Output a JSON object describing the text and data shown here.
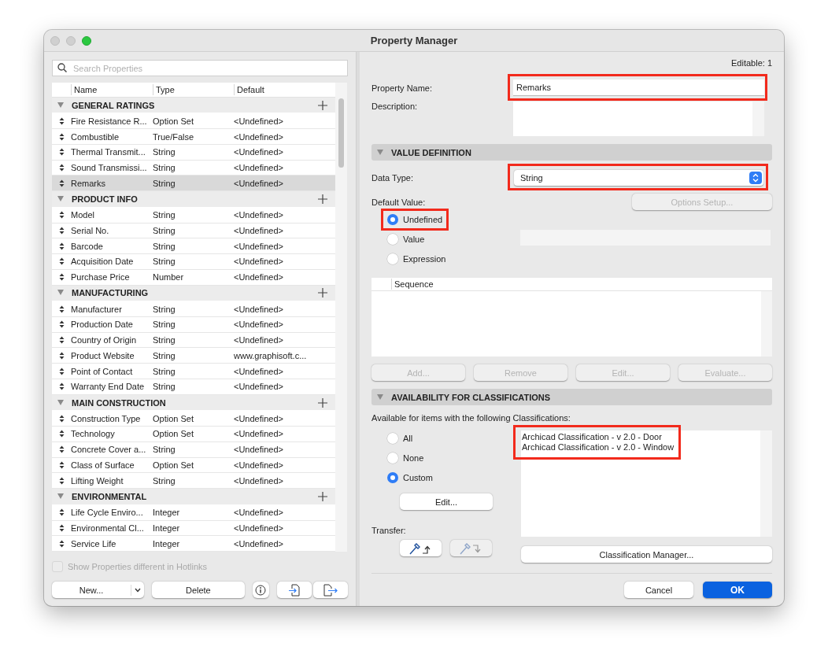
{
  "window": {
    "title": "Property Manager"
  },
  "search": {
    "placeholder": "Search Properties"
  },
  "table": {
    "columns": [
      "Name",
      "Type",
      "Default"
    ],
    "groups": [
      {
        "name": "GENERAL RATINGS",
        "expanded": true,
        "rows": [
          {
            "name": "Fire Resistance R...",
            "type": "Option Set",
            "default": "<Undefined>",
            "selected": false
          },
          {
            "name": "Combustible",
            "type": "True/False",
            "default": "<Undefined>",
            "selected": false
          },
          {
            "name": "Thermal Transmit...",
            "type": "String",
            "default": "<Undefined>",
            "selected": false
          },
          {
            "name": "Sound Transmissi...",
            "type": "String",
            "default": "<Undefined>",
            "selected": false
          },
          {
            "name": "Remarks",
            "type": "String",
            "default": "<Undefined>",
            "selected": true
          }
        ]
      },
      {
        "name": "PRODUCT INFO",
        "expanded": true,
        "rows": [
          {
            "name": "Model",
            "type": "String",
            "default": "<Undefined>",
            "selected": false
          },
          {
            "name": "Serial No.",
            "type": "String",
            "default": "<Undefined>",
            "selected": false
          },
          {
            "name": "Barcode",
            "type": "String",
            "default": "<Undefined>",
            "selected": false
          },
          {
            "name": "Acquisition Date",
            "type": "String",
            "default": "<Undefined>",
            "selected": false
          },
          {
            "name": "Purchase Price",
            "type": "Number",
            "default": "<Undefined>",
            "selected": false
          }
        ]
      },
      {
        "name": "MANUFACTURING",
        "expanded": true,
        "rows": [
          {
            "name": "Manufacturer",
            "type": "String",
            "default": "<Undefined>",
            "selected": false
          },
          {
            "name": "Production Date",
            "type": "String",
            "default": "<Undefined>",
            "selected": false
          },
          {
            "name": "Country of Origin",
            "type": "String",
            "default": "<Undefined>",
            "selected": false
          },
          {
            "name": "Product Website",
            "type": "String",
            "default": "www.graphisoft.c...",
            "selected": false
          },
          {
            "name": "Point of Contact",
            "type": "String",
            "default": "<Undefined>",
            "selected": false
          },
          {
            "name": "Warranty End Date",
            "type": "String",
            "default": "<Undefined>",
            "selected": false
          }
        ]
      },
      {
        "name": "MAIN CONSTRUCTION",
        "expanded": true,
        "rows": [
          {
            "name": "Construction Type",
            "type": "Option Set",
            "default": "<Undefined>",
            "selected": false
          },
          {
            "name": "Technology",
            "type": "Option Set",
            "default": "<Undefined>",
            "selected": false
          },
          {
            "name": "Concrete Cover a...",
            "type": "String",
            "default": "<Undefined>",
            "selected": false
          },
          {
            "name": "Class of Surface",
            "type": "Option Set",
            "default": "<Undefined>",
            "selected": false
          },
          {
            "name": "Lifting Weight",
            "type": "String",
            "default": "<Undefined>",
            "selected": false
          }
        ]
      },
      {
        "name": "ENVIRONMENTAL",
        "expanded": true,
        "rows": [
          {
            "name": "Life Cycle Enviro...",
            "type": "Integer",
            "default": "<Undefined>",
            "selected": false
          },
          {
            "name": "Environmental Cl...",
            "type": "Integer",
            "default": "<Undefined>",
            "selected": false
          },
          {
            "name": "Service Life",
            "type": "Integer",
            "default": "<Undefined>",
            "selected": false
          }
        ]
      }
    ]
  },
  "hotlinks_checkbox": {
    "label": "Show Properties different in Hotlinks",
    "checked": false,
    "disabled": true
  },
  "left_buttons": {
    "new": "New...",
    "delete": "Delete"
  },
  "editable": "Editable: 1",
  "property_name": {
    "label": "Property Name:",
    "value": "Remarks",
    "highlighted": true
  },
  "description": {
    "label": "Description:"
  },
  "value_definition": {
    "title": "VALUE DEFINITION",
    "expanded": true,
    "data_type": {
      "label": "Data Type:",
      "value": "String",
      "highlighted": true
    },
    "default_value_label": "Default Value:",
    "options_setup": {
      "label": "Options Setup...",
      "disabled": true
    },
    "options": [
      {
        "label": "Undefined",
        "selected": true,
        "highlighted": true
      },
      {
        "label": "Value",
        "selected": false,
        "highlighted": false
      },
      {
        "label": "Expression",
        "selected": false,
        "highlighted": false
      }
    ],
    "sequence_column": "Sequence",
    "buttons": [
      {
        "label": "Add...",
        "disabled": true
      },
      {
        "label": "Remove",
        "disabled": true
      },
      {
        "label": "Edit...",
        "disabled": true
      },
      {
        "label": "Evaluate...",
        "disabled": true
      }
    ]
  },
  "availability": {
    "title": "AVAILABILITY FOR CLASSIFICATIONS",
    "expanded": true,
    "caption": "Available for items with the following Classifications:",
    "options": [
      {
        "label": "All",
        "selected": false
      },
      {
        "label": "None",
        "selected": false
      },
      {
        "label": "Custom",
        "selected": true
      }
    ],
    "edit_button": "Edit...",
    "classifications": [
      "Archicad Classification - v 2.0 - Door",
      "Archicad Classification - v 2.0 - Window"
    ],
    "classifications_highlighted": true,
    "transfer_label": "Transfer:",
    "transfer_buttons": [
      {
        "disabled": false
      },
      {
        "disabled": true
      }
    ],
    "manager_button": "Classification Manager..."
  },
  "footer": {
    "cancel": "Cancel",
    "ok": "OK"
  }
}
